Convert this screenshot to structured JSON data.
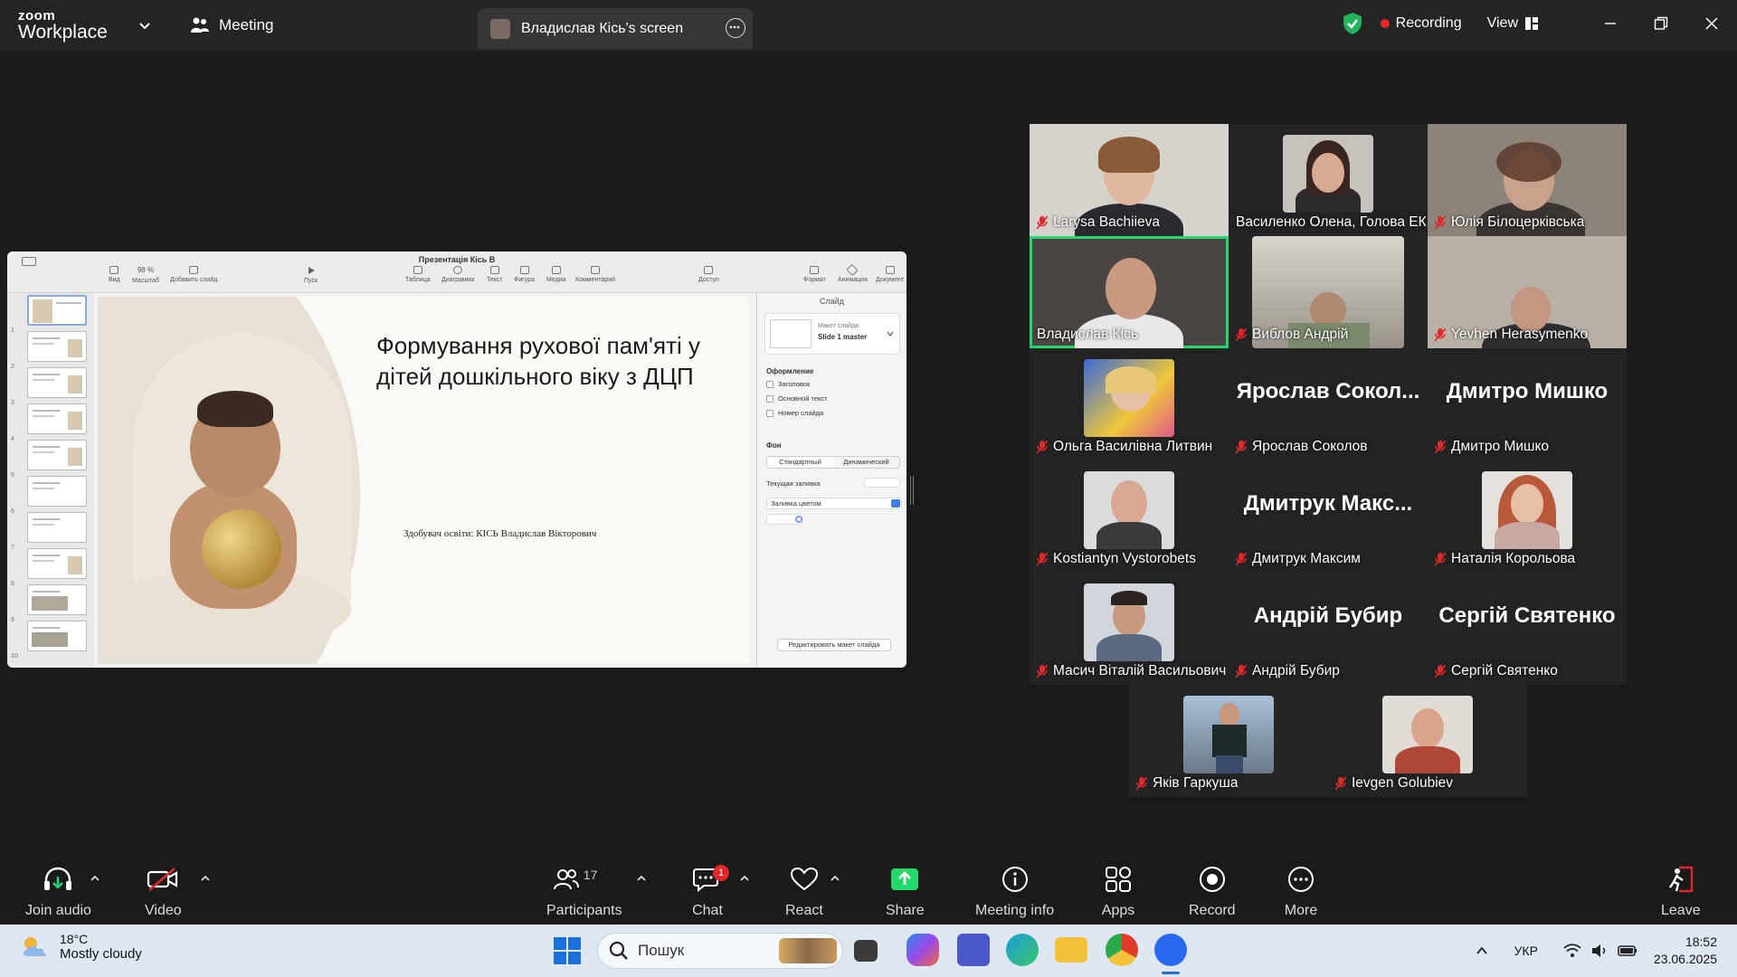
{
  "app": {
    "logo_line1": "zoom",
    "logo_line2": "Workplace",
    "meeting_tab": "Meeting",
    "screen_tab": "Владислав Кісь's screen",
    "recording": "Recording",
    "view": "View"
  },
  "presentation": {
    "doc_title": "Презентація Кісь В",
    "zoom_level": "98 %",
    "toolbar": {
      "view": "Вид",
      "scale": "Масштаб",
      "add_slide": "Добавить слайд",
      "play": "Пуск",
      "table": "Таблица",
      "chart": "Диаграмма",
      "text": "Текст",
      "shape": "Фигура",
      "media": "Медиа",
      "comment": "Комментарий",
      "share": "Доступ",
      "format": "Формат",
      "animate": "Анимация",
      "document": "Документ"
    },
    "thumb_numbers": [
      "1",
      "2",
      "3",
      "4",
      "5",
      "6",
      "7",
      "8",
      "9",
      "10"
    ],
    "slide_heading": "Формування рухової пам'яті у дітей дошкільного віку з ДЦП",
    "slide_author": "Здобувач освіти: КІСЬ Владислав Вікторович",
    "inspector": {
      "header": "Слайд",
      "master_label": "Макет слайда",
      "master_name": "Slide 1 master",
      "appearance": "Оформление",
      "chk_title": "Заголовок",
      "chk_body": "Основной текст",
      "chk_number": "Номер слайда",
      "background": "Фон",
      "seg_standard": "Стандартный",
      "seg_dynamic": "Динамический",
      "current_fill": "Текущая заливка",
      "fill_type": "Заливка цветом",
      "edit_master": "Редактировать макет слайда"
    }
  },
  "participants_tiles": [
    {
      "name": "Larysa Bachiieva"
    },
    {
      "name": "Василенко Олена, Голова ЕК"
    },
    {
      "name": "Юлія Білоцерківська"
    },
    {
      "name": "Владислав Кісь"
    },
    {
      "name": "Виблов  Андрій"
    },
    {
      "name": "Yevhen Herasymenko"
    },
    {
      "name": "Ольга Василівна Литвин"
    },
    {
      "name": "Ярослав Соколов",
      "big": "Ярослав  Сокол..."
    },
    {
      "name": "Дмитро Мишко",
      "big": "Дмитро Мишко"
    },
    {
      "name": "Kostiantyn Vystorobets"
    },
    {
      "name": "Дмитрук Максим",
      "big": "Дмитрук  Макс..."
    },
    {
      "name": "Наталія Корольова"
    },
    {
      "name": "Масич Віталій Васильович"
    },
    {
      "name": "Андрій Бубир",
      "big": "Андрій Бубир"
    },
    {
      "name": "Сергій Святенко",
      "big": "Сергій Святенко"
    },
    {
      "name": "Яків Гаркуша"
    },
    {
      "name": "Ievgen Golubiev"
    }
  ],
  "toolbar": {
    "join_audio": "Join audio",
    "video": "Video",
    "participants": "Participants",
    "participants_count": "17",
    "chat": "Chat",
    "chat_badge": "1",
    "react": "React",
    "share": "Share",
    "meeting_info": "Meeting info",
    "apps": "Apps",
    "record": "Record",
    "more": "More",
    "leave": "Leave"
  },
  "taskbar": {
    "temp": "18°C",
    "weather": "Mostly cloudy",
    "search": "Пошук",
    "lang": "УКР",
    "time": "18:52",
    "date": "23.06.2025"
  },
  "colors": {
    "accent_green": "#23d96b",
    "recording_red": "#e02828",
    "share_green": "#23d96b",
    "mic_muted_red": "#e02828"
  }
}
